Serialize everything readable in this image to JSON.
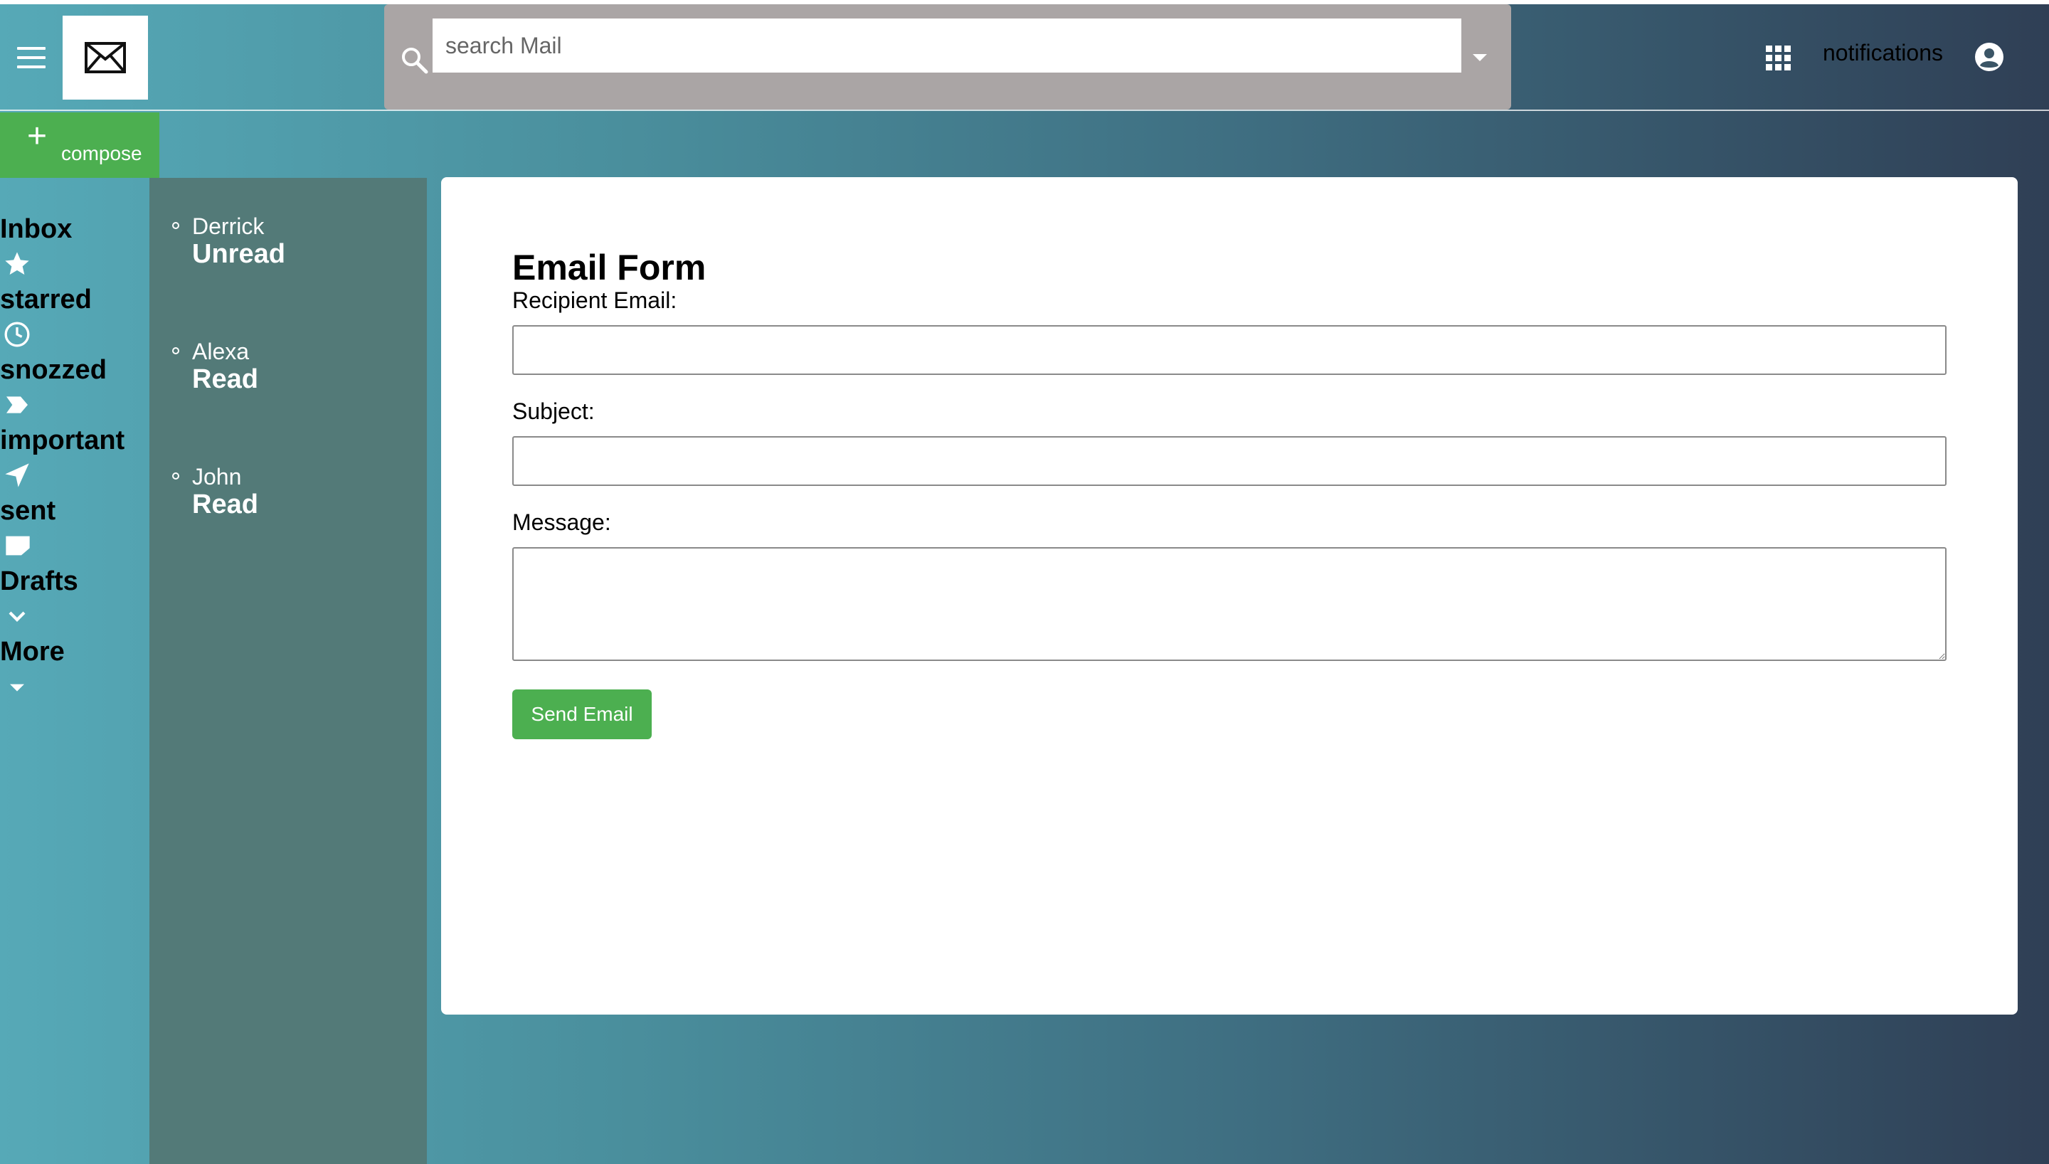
{
  "header": {
    "search": {
      "placeholder": "search Mail",
      "value": ""
    },
    "notifications_label": "notifications"
  },
  "compose": {
    "label": "compose"
  },
  "nav": {
    "items": [
      {
        "label": "Inbox",
        "icon": "star-icon"
      },
      {
        "label": "starred",
        "icon": "clock-icon"
      },
      {
        "label": "snozzed",
        "icon": "label-arrow-icon"
      },
      {
        "label": "important",
        "icon": "send-icon"
      },
      {
        "label": "sent",
        "icon": "draft-icon"
      },
      {
        "label": "Drafts",
        "icon": "chevron-down-icon"
      },
      {
        "label": "More",
        "icon": "caret-down-icon"
      }
    ]
  },
  "emails": [
    {
      "sender": "Derrick",
      "status": "Unread"
    },
    {
      "sender": "Alexa",
      "status": "Read"
    },
    {
      "sender": "John",
      "status": "Read"
    }
  ],
  "form": {
    "title": "Email Form",
    "recipient_label": "Recipient Email:",
    "recipient_value": "",
    "subject_label": "Subject:",
    "subject_value": "",
    "message_label": "Message:",
    "message_value": "",
    "send_label": "Send Email"
  },
  "colors": {
    "accent_green": "#4caf50",
    "search_bar_bg": "#aaa5a5",
    "email_list_bg": "#537a78",
    "gradient_start": "#56a9b7",
    "gradient_end": "#2f3f55"
  }
}
